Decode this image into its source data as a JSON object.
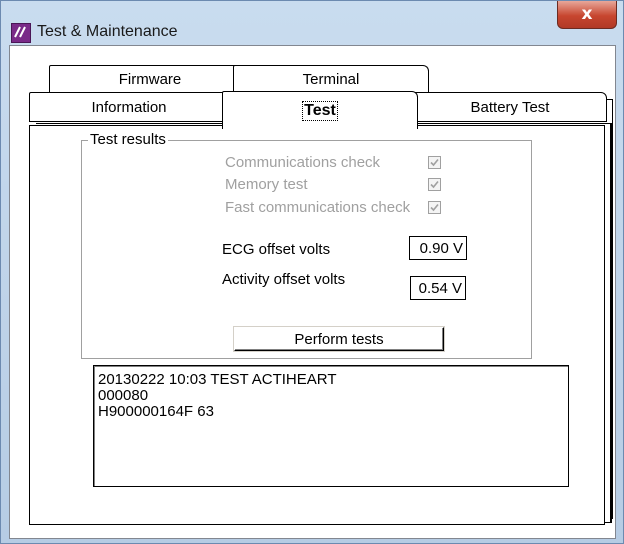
{
  "window": {
    "title": "Test & Maintenance",
    "close_glyph": "x"
  },
  "tabs": {
    "row1": [
      {
        "label": "Firmware"
      },
      {
        "label": "Terminal"
      }
    ],
    "row2": [
      {
        "label": "Information"
      },
      {
        "label": "Test",
        "active": true
      },
      {
        "label": "Battery Test"
      }
    ]
  },
  "test_results": {
    "legend": "Test results",
    "checks": [
      {
        "label": "Communications check",
        "checked": true,
        "enabled": false
      },
      {
        "label": "Memory test",
        "checked": true,
        "enabled": false
      },
      {
        "label": "Fast communications check",
        "checked": true,
        "enabled": false
      }
    ],
    "fields": [
      {
        "label": "ECG offset volts",
        "value": "0.90 V"
      },
      {
        "label": "Activity offset volts",
        "value": "0.54 V"
      }
    ]
  },
  "perform_button": {
    "label": "Perform tests"
  },
  "log": {
    "lines": [
      "20130222 10:03 TEST ACTIHEART",
      "000080",
      "H900000164F 63"
    ]
  },
  "colors": {
    "close_red": "#c7462f",
    "disabled_text": "#a0a0a0",
    "icon_purple": "#7a2a88"
  },
  "icons": {
    "app": "app-logo-icon",
    "close": "close-icon",
    "check": "check-icon"
  }
}
